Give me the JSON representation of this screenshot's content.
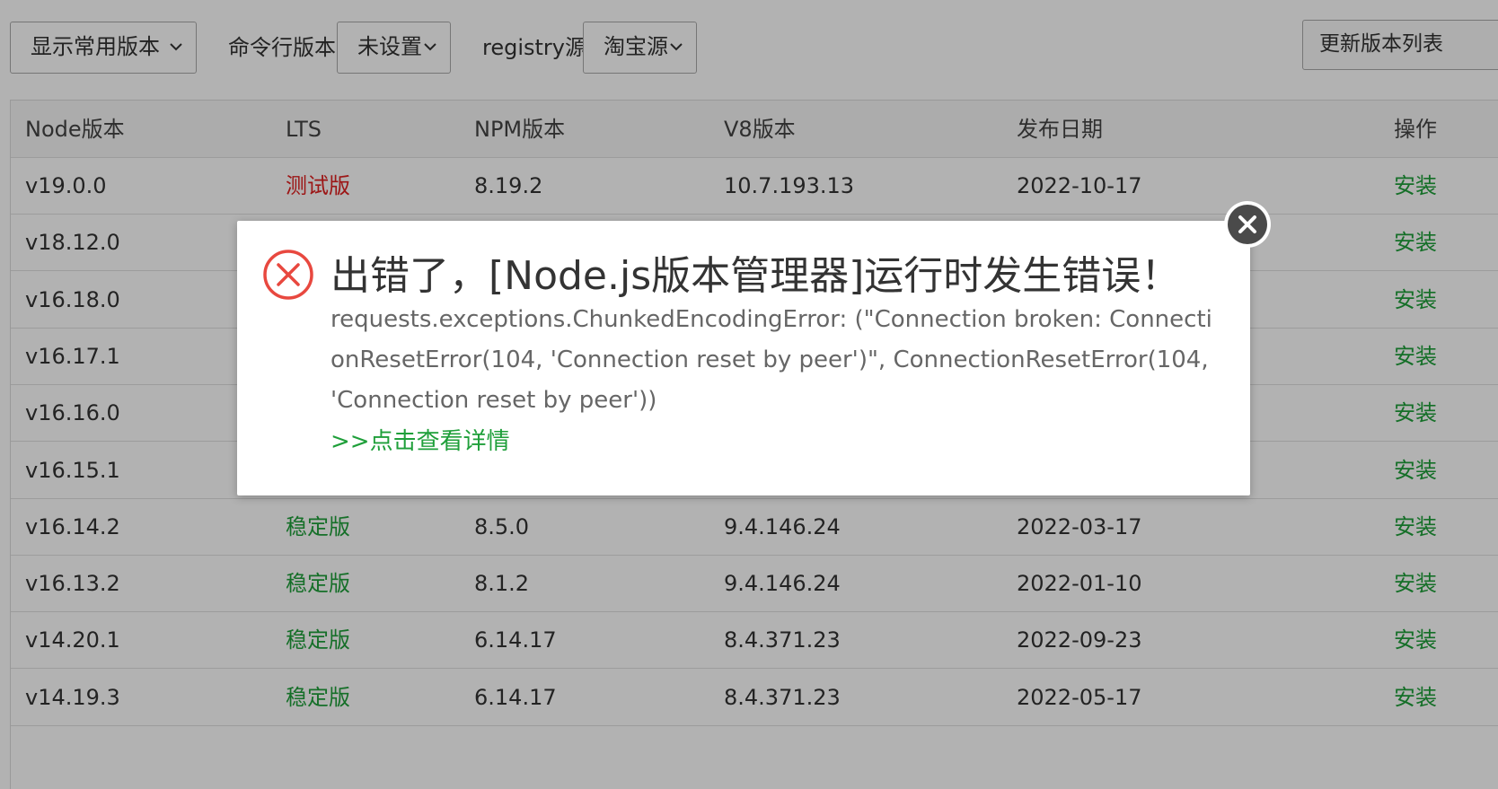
{
  "toolbar": {
    "version_filter": "显示常用版本",
    "cli_label": "命令行版本",
    "cli_value": "未设置",
    "registry_label": "registry源",
    "registry_value": "淘宝源",
    "update_button": "更新版本列表"
  },
  "table": {
    "headers": [
      "Node版本",
      "LTS",
      "NPM版本",
      "V8版本",
      "发布日期",
      "操作"
    ],
    "rows": [
      {
        "node": "v19.0.0",
        "lts": "测试版",
        "lts_type": "beta",
        "npm": "8.19.2",
        "v8": "10.7.193.13",
        "date": "2022-10-17",
        "action": "安装"
      },
      {
        "node": "v18.12.0",
        "lts": "",
        "lts_type": "stable",
        "npm": "",
        "v8": "",
        "date": "",
        "action": "安装"
      },
      {
        "node": "v16.18.0",
        "lts": "",
        "lts_type": "stable",
        "npm": "",
        "v8": "",
        "date": "",
        "action": "安装"
      },
      {
        "node": "v16.17.1",
        "lts": "",
        "lts_type": "stable",
        "npm": "",
        "v8": "",
        "date": "",
        "action": "安装"
      },
      {
        "node": "v16.16.0",
        "lts": "",
        "lts_type": "stable",
        "npm": "",
        "v8": "",
        "date": "",
        "action": "安装"
      },
      {
        "node": "v16.15.1",
        "lts": "",
        "lts_type": "stable",
        "npm": "",
        "v8": "",
        "date": "",
        "action": "安装"
      },
      {
        "node": "v16.14.2",
        "lts": "稳定版",
        "lts_type": "stable",
        "npm": "8.5.0",
        "v8": "9.4.146.24",
        "date": "2022-03-17",
        "action": "安装"
      },
      {
        "node": "v16.13.2",
        "lts": "稳定版",
        "lts_type": "stable",
        "npm": "8.1.2",
        "v8": "9.4.146.24",
        "date": "2022-01-10",
        "action": "安装"
      },
      {
        "node": "v14.20.1",
        "lts": "稳定版",
        "lts_type": "stable",
        "npm": "6.14.17",
        "v8": "8.4.371.23",
        "date": "2022-09-23",
        "action": "安装"
      },
      {
        "node": "v14.19.3",
        "lts": "稳定版",
        "lts_type": "stable",
        "npm": "6.14.17",
        "v8": "8.4.371.23",
        "date": "2022-05-17",
        "action": "安装"
      }
    ]
  },
  "dialog": {
    "title": "出错了，[Node.js版本管理器]运行时发生错误！",
    "message": "requests.exceptions.ChunkedEncodingError: (\"Connection broken: ConnectionResetError(104, 'Connection reset by peer')\", ConnectionResetError(104, 'Connection reset by peer'))",
    "details_link": ">>点击查看详情"
  },
  "icons": {
    "dialog": "error-circle-icon",
    "close": "close-icon",
    "dropdown": "chevron-down-icon"
  },
  "colors": {
    "error": "#e8483f",
    "beta": "#e02020",
    "stable": "#1f9f3a",
    "link": "#1f9f3a"
  }
}
